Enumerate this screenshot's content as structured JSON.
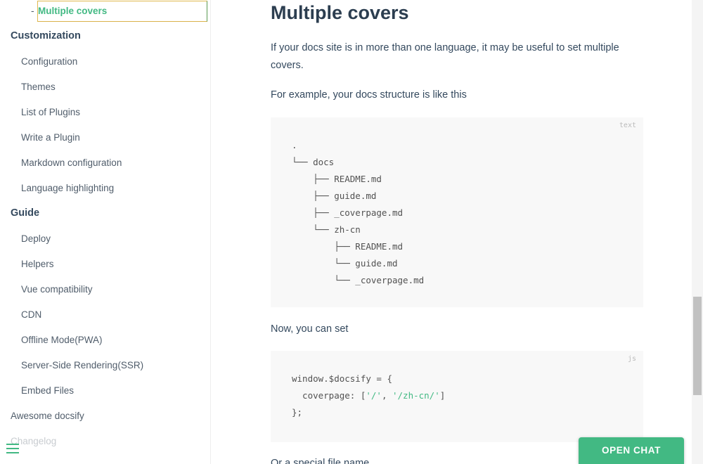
{
  "sidebar": {
    "active_item": "Multiple covers",
    "sections": [
      {
        "title": "Customization",
        "items": [
          "Configuration",
          "Themes",
          "List of Plugins",
          "Write a Plugin",
          "Markdown configuration",
          "Language highlighting"
        ]
      },
      {
        "title": "Guide",
        "items": [
          "Deploy",
          "Helpers",
          "Vue compatibility",
          "CDN",
          "Offline Mode(PWA)",
          "Server-Side Rendering(SSR)",
          "Embed Files"
        ]
      }
    ],
    "top_links": [
      "Awesome docsify",
      "Changelog"
    ]
  },
  "content": {
    "heading": "Multiple covers",
    "para1": "If your docs site is in more than one language, it may be useful to set multiple covers.",
    "para2": "For example, your docs structure is like this",
    "code1": {
      "lang": "text",
      "lines": [
        ".",
        "└── docs",
        "    ├── README.md",
        "    ├── guide.md",
        "    ├── _coverpage.md",
        "    └── zh-cn",
        "        ├── README.md",
        "        └── guide.md",
        "        └── _coverpage.md"
      ]
    },
    "para3": "Now, you can set",
    "code2": {
      "lang": "js",
      "line1": "window.$docsify = {",
      "line2_pre": "  coverpage: [",
      "line2_s1": "'/'",
      "line2_sep": ", ",
      "line2_s2": "'/zh-cn/'",
      "line2_post": "]",
      "line3": "};"
    },
    "para4": "Or a special file name"
  },
  "chat_button": "OPEN CHAT",
  "colors": {
    "accent": "#42b983",
    "text": "#34495e",
    "code_bg": "#f8f8f8"
  }
}
